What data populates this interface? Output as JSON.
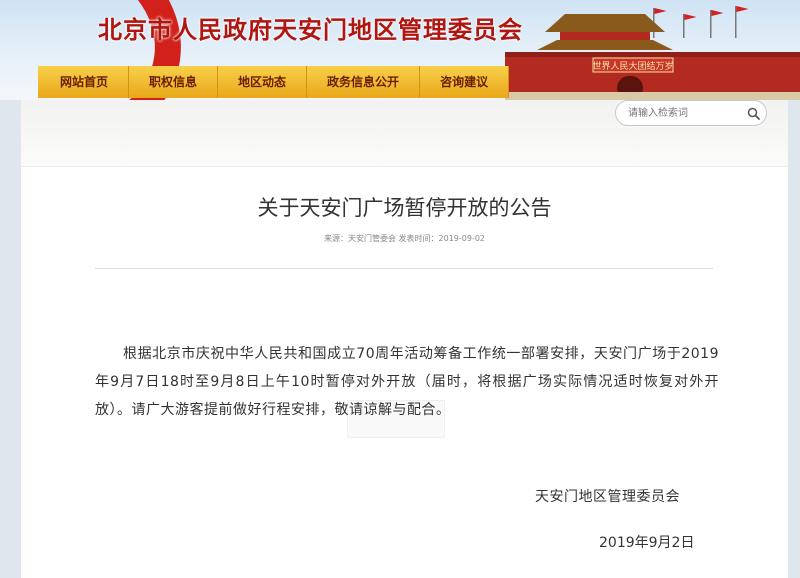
{
  "header": {
    "site_title": "北京市人民政府天安门地区管理委员会",
    "banner_text": "世界人民大团结万岁"
  },
  "nav": {
    "items": [
      "网站首页",
      "职权信息",
      "地区动态",
      "政务信息公开",
      "咨询建议"
    ]
  },
  "search": {
    "placeholder": "请输入检索词"
  },
  "article": {
    "title": "关于天安门广场暂停开放的公告",
    "meta": "来源：天安门管委会 发表时间：2019-09-02",
    "body": "根据北京市庆祝中华人民共和国成立70周年活动筹备工作统一部署安排，天安门广场于2019年9月7日18时至9月8日上午10时暂停对外开放（届时，将根据广场实际情况适时恢复对外开放）。请广大游客提前做好行程安排，敬请谅解与配合。",
    "signature": "天安门地区管理委员会",
    "date": "2019年9月2日"
  },
  "colors": {
    "nav_bg": "#eaa71a",
    "title_red": "#b0160f"
  }
}
